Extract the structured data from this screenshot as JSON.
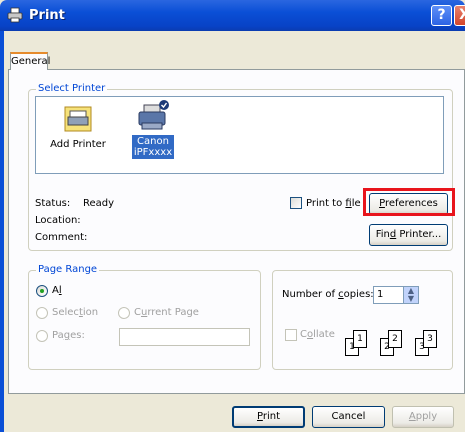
{
  "window": {
    "title": "Print",
    "help_button": "?",
    "close_button": "X"
  },
  "tabs": [
    {
      "label": "General"
    }
  ],
  "select_printer": {
    "legend": "Select Printer",
    "items": [
      {
        "label": "Add Printer",
        "icon": "add-printer-icon"
      },
      {
        "label_line1": "Canon",
        "label_line2": "iPFxxxx",
        "icon": "printer-icon",
        "selected": true
      }
    ],
    "status_label": "Status:",
    "status_value": "Ready",
    "location_label": "Location:",
    "comment_label": "Comment:",
    "print_to_file_prefix": "Print to ",
    "print_to_file_accel": "f",
    "print_to_file_suffix": "ile",
    "preferences_accel": "P",
    "preferences_rest": "references",
    "find_printer_prefix": "Fin",
    "find_printer_accel": "d",
    "find_printer_suffix": " Printer..."
  },
  "page_range": {
    "legend": "Page Range",
    "all_accel": "l",
    "all_prefix": "A",
    "all_suffix": "l",
    "selection_prefix": "Selec",
    "selection_accel": "t",
    "selection_suffix": "ion",
    "current_page_prefix": "C",
    "current_page_accel": "u",
    "current_page_suffix": "rrent Page",
    "pages_prefix": "Pa",
    "pages_accel": "g",
    "pages_suffix": "es:",
    "pages_value": ""
  },
  "copies": {
    "label_prefix": "Number of ",
    "label_accel": "c",
    "label_suffix": "opies:",
    "value": "1",
    "collate_prefix": "C",
    "collate_accel": "o",
    "collate_suffix": "llate",
    "collate_pages": [
      "1",
      "1",
      "2",
      "2",
      "3",
      "3"
    ]
  },
  "footer": {
    "print_accel": "P",
    "print_rest": "rint",
    "cancel": "Cancel",
    "apply_accel": "A",
    "apply_rest": "pply"
  },
  "colors": {
    "highlight": "#e8141c",
    "titlebar": "#0a4fd6"
  }
}
